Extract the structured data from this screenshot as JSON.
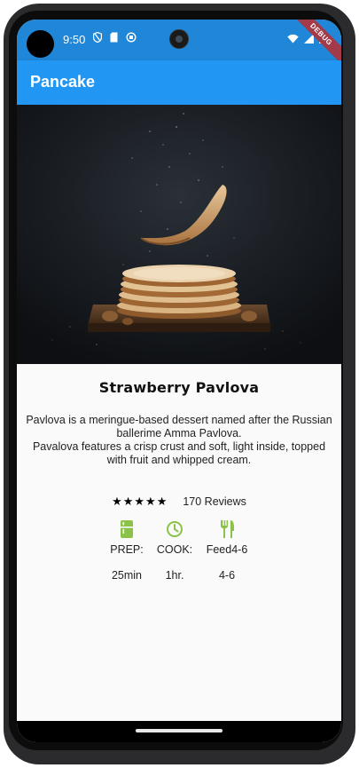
{
  "status_bar": {
    "time": "9:50",
    "debug_label": "DEBUG"
  },
  "app_bar": {
    "title": "Pancake"
  },
  "hero_image": {
    "alt": "pancake stack photo"
  },
  "recipe": {
    "title": "Strawberry Pavlova",
    "description_line1": "Pavlova is a meringue-based dessert named after the Russian ballerime Amma Pavlova.",
    "description_line2": "Pavalova features a crisp crust and soft, light inside, topped with fruit and whipped cream.",
    "rating_stars": 5,
    "reviews": "170 Reviews",
    "info": [
      {
        "icon": "kitchen-icon",
        "label": "PREP:",
        "value": "25min"
      },
      {
        "icon": "timer-icon",
        "label": "COOK:",
        "value": "1hr."
      },
      {
        "icon": "restaurant-icon",
        "label": "Feed4-6",
        "value": "4-6"
      }
    ]
  },
  "colors": {
    "primary": "#2196f3",
    "status_bar": "#1f86d8",
    "icon_green": "#8bc34a"
  }
}
